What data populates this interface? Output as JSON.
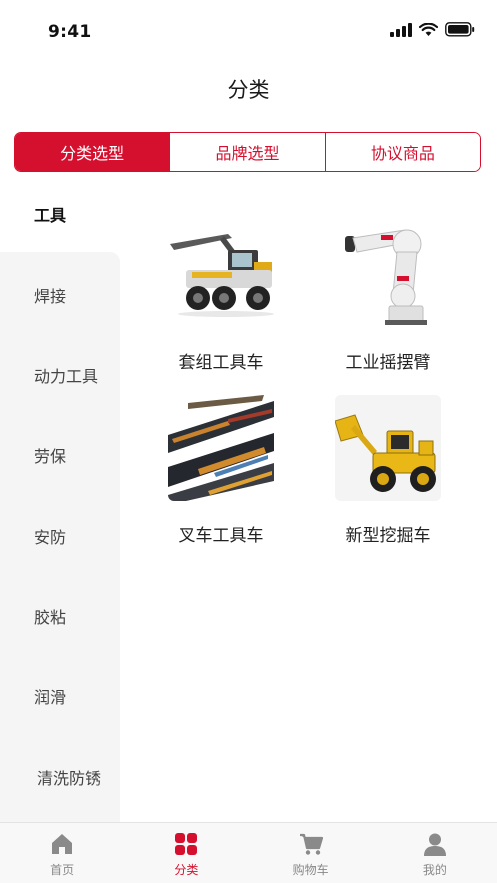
{
  "status": {
    "time": "9:41"
  },
  "nav": {
    "title": "分类"
  },
  "segments": [
    {
      "label": "分类选型",
      "active": true
    },
    {
      "label": "品牌选型",
      "active": false
    },
    {
      "label": "协议商品",
      "active": false
    }
  ],
  "sidebar": {
    "items": [
      {
        "label": "工具"
      },
      {
        "label": "焊接"
      },
      {
        "label": "动力工具"
      },
      {
        "label": "劳保"
      },
      {
        "label": "安防"
      },
      {
        "label": "胶粘"
      },
      {
        "label": "润滑"
      },
      {
        "label": "清洗防锈"
      }
    ]
  },
  "products": [
    {
      "label": "套组工具车",
      "icon": "forestry-harvester-image"
    },
    {
      "label": "工业摇摆臂",
      "icon": "industrial-robot-arm-image"
    },
    {
      "label": "叉车工具车",
      "icon": "abstract-stripes-image"
    },
    {
      "label": "新型挖掘车",
      "icon": "wheel-loader-image"
    }
  ],
  "tabbar": {
    "items": [
      {
        "label": "首页",
        "icon": "home-icon"
      },
      {
        "label": "分类",
        "icon": "category-grid-icon",
        "active": true
      },
      {
        "label": "购物车",
        "icon": "cart-icon"
      },
      {
        "label": "我的",
        "icon": "user-icon"
      }
    ]
  },
  "colors": {
    "accent": "#d5102f",
    "sidebar_bg": "#f5f5f5",
    "tabbar_bg": "#f8f8f8"
  }
}
